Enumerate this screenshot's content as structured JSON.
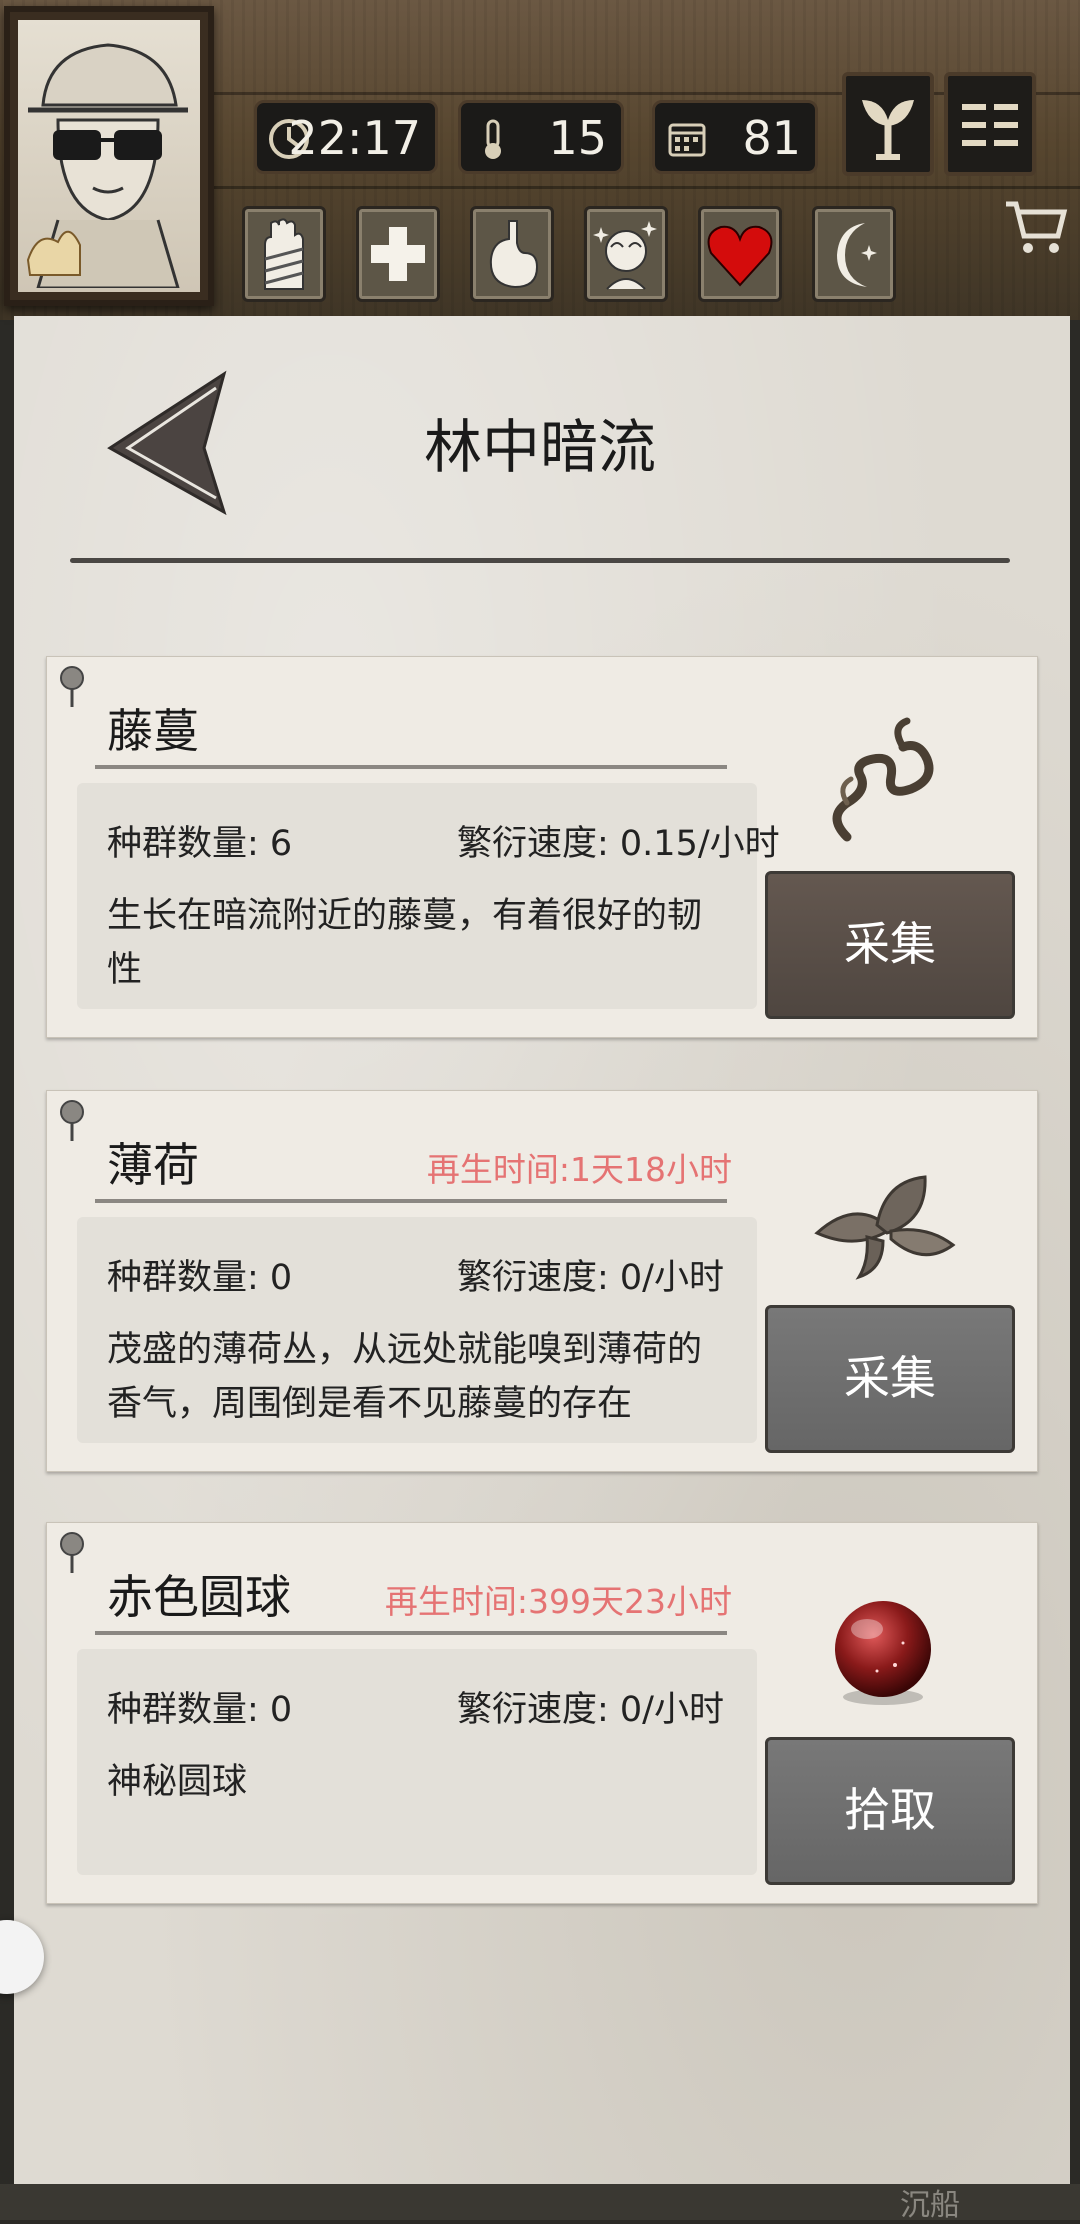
{
  "colors": {
    "accent_regen": "#e57373",
    "parchment": "#dedad2",
    "wood": "#57462f"
  },
  "status": {
    "time": "22:17",
    "temperature": "15",
    "day": "81"
  },
  "icons": {
    "time": "clock-icon",
    "temperature": "thermometer-icon",
    "day": "calendar-icon",
    "sprout": "sprout-icon",
    "menu": "menu-icon",
    "cart": "cart-icon",
    "status": [
      "bandaged-hand-icon",
      "cross-icon",
      "stomach-icon",
      "sparkle-head-icon",
      "heart-icon",
      "moon-icon"
    ]
  },
  "page": {
    "title": "林中暗流"
  },
  "resources": [
    {
      "name": "藤蔓",
      "regen": "",
      "population": "种群数量: 6",
      "rate": "繁衍速度: 0.15/小时",
      "description": "生长在暗流附近的藤蔓，有着很好的韧性",
      "action": "采集",
      "icon": "vine-icon"
    },
    {
      "name": "薄荷",
      "regen": "再生时间:1天18小时",
      "population": "种群数量: 0",
      "rate": "繁衍速度: 0/小时",
      "description": "茂盛的薄荷丛，从远处就能嗅到薄荷的香气，周围倒是看不见藤蔓的存在",
      "action": "采集",
      "icon": "mint-leaf-icon"
    },
    {
      "name": "赤色圆球",
      "regen": "再生时间:399天23小时",
      "population": "种群数量: 0",
      "rate": "繁衍速度: 0/小时",
      "description": "神秘圆球",
      "action": "拾取",
      "icon": "red-orb-icon"
    }
  ],
  "bottom": {
    "hint": "沉船"
  }
}
